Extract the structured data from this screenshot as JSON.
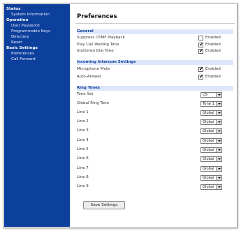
{
  "sidebar": {
    "sections": [
      {
        "title": "Status",
        "items": [
          "System Information"
        ]
      },
      {
        "title": "Operation",
        "items": [
          "User Password",
          "Programmable Keys",
          "Directory",
          "Reset"
        ]
      },
      {
        "title": "Basic Settings",
        "items": [
          "Preferences",
          "Call Forward"
        ]
      }
    ]
  },
  "page": {
    "title": "Preferences"
  },
  "general": {
    "heading": "General",
    "rows": [
      {
        "label": "Suppress DTMF Playback",
        "checked": false,
        "option": "Enabled"
      },
      {
        "label": "Play Call Waiting Tone",
        "checked": true,
        "option": "Enabled"
      },
      {
        "label": "Stuttered Dial Tone",
        "checked": true,
        "option": "Enabled"
      }
    ]
  },
  "intercom": {
    "heading": "Incoming Intercom Settings",
    "rows": [
      {
        "label": "Microphone Mute",
        "checked": true,
        "option": "Enabled"
      },
      {
        "label": "Auto-Answer",
        "checked": true,
        "option": "Enabled"
      }
    ]
  },
  "ring_tones": {
    "heading": "Ring Tones",
    "rows": [
      {
        "label": "Tone Set",
        "value": "US"
      },
      {
        "label": "Global Ring Tone",
        "value": "Tone 1"
      },
      {
        "label": "Line 1",
        "value": "Global"
      },
      {
        "label": "Line 2",
        "value": "Global"
      },
      {
        "label": "Line 3",
        "value": "Global"
      },
      {
        "label": "Line 4",
        "value": "Global"
      },
      {
        "label": "Line 5",
        "value": "Global"
      },
      {
        "label": "Line 6",
        "value": "Global"
      },
      {
        "label": "Line 7",
        "value": "Global"
      },
      {
        "label": "Line 8",
        "value": "Global"
      },
      {
        "label": "Line 9",
        "value": "Global"
      }
    ]
  },
  "actions": {
    "save_label": "Save Settings"
  },
  "colors": {
    "sidebar_bg": "#0d3f9c",
    "section_bg": "#dde6fb",
    "section_text": "#0d3f9c"
  }
}
